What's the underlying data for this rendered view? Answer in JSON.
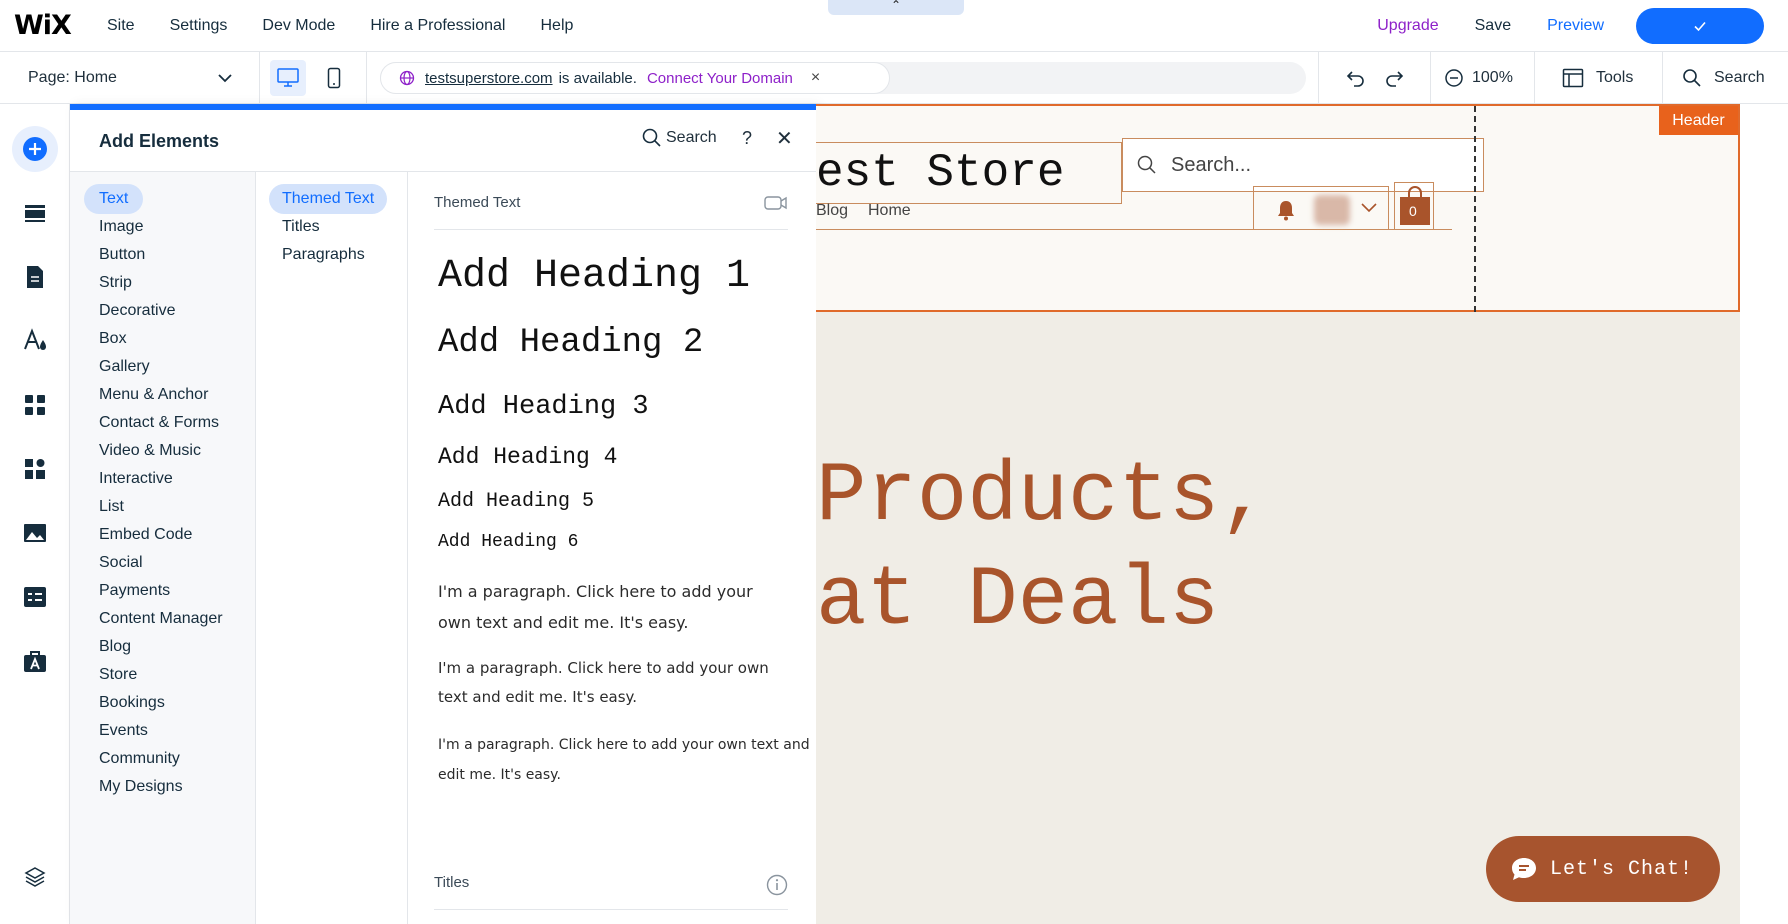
{
  "app": {
    "logo": "WiX"
  },
  "topmenu": {
    "items": [
      "Site",
      "Settings",
      "Dev Mode",
      "Hire a Professional",
      "Help"
    ],
    "notch": "⌃",
    "upgrade": "Upgrade",
    "save": "Save",
    "preview": "Preview",
    "publish_icon": "check-icon"
  },
  "toolbar": {
    "page_label": "Page:",
    "page_value": "Home",
    "domain": "testsuperstore.com",
    "available": "is available.",
    "connect": "Connect Your Domain",
    "close": "×",
    "zoom": "100%",
    "tools": "Tools",
    "search": "Search"
  },
  "panel": {
    "title": "Add Elements",
    "search": "Search",
    "help": "?",
    "close": "✕",
    "categories": [
      "Text",
      "Image",
      "Button",
      "Strip",
      "Decorative",
      "Box",
      "Gallery",
      "Menu & Anchor",
      "Contact & Forms",
      "Video & Music",
      "Interactive",
      "List",
      "Embed Code",
      "Social",
      "Payments",
      "Content Manager",
      "Blog",
      "Store",
      "Bookings",
      "Events",
      "Community",
      "My Designs"
    ],
    "selected_category": "Text",
    "subcategories": [
      "Themed Text",
      "Titles",
      "Paragraphs"
    ],
    "selected_subcategory": "Themed Text",
    "section_themed": "Themed Text",
    "headings": [
      "Add Heading 1",
      "Add Heading 2",
      "Add Heading 3",
      "Add Heading 4",
      "Add Heading 5",
      "Add Heading 6"
    ],
    "paragraphs": [
      "I'm a paragraph. Click here to add your own text and edit me. It's easy.",
      "I'm a paragraph. Click here to add your own text and edit me. It's easy.",
      "I'm a paragraph. Click here to add your own text and edit me. It's easy."
    ],
    "section_titles": "Titles"
  },
  "canvas": {
    "header_label": "Header",
    "site_title": "est Store",
    "search_placeholder": "Search...",
    "nav": [
      "Blog",
      "Home"
    ],
    "cart_count": "0",
    "hero_line1": "Products,",
    "hero_line2": "at Deals",
    "chat": "Let's Chat!"
  },
  "colors": {
    "accent": "#116dff",
    "upgrade": "#8e21c9",
    "header_outline": "#e06a2b",
    "brand_brown": "#a9542b"
  }
}
